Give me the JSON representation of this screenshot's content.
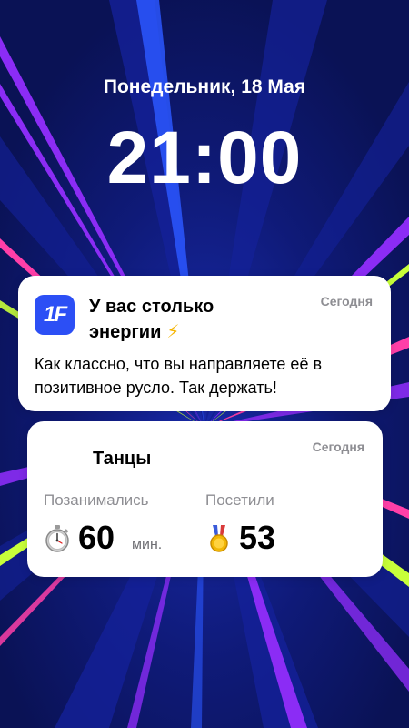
{
  "lockscreen": {
    "date": "Понедельник, 18 Мая",
    "time": "21:00"
  },
  "notification": {
    "app_icon_text": "1F",
    "title": "У вас столько энергии",
    "title_emoji": "⚡",
    "timestamp": "Сегодня",
    "body": "Как классно, что вы направляете её в позитивное русло. Так держать!"
  },
  "widget": {
    "title": "Танцы",
    "timestamp": "Сегодня",
    "stats": [
      {
        "label": "Позанимались",
        "value": "60",
        "unit": "мин.",
        "icon": "stopwatch-icon"
      },
      {
        "label": "Посетили",
        "value": "53",
        "icon": "medal-icon"
      }
    ]
  },
  "colors": {
    "background": "#0c1560",
    "accent_blue": "#2c4ff5",
    "ray_purple": "#8b2cf5",
    "ray_pink": "#ff3fa8",
    "ray_lime": "#c8ff3a",
    "muted_text": "#8e8e93"
  }
}
